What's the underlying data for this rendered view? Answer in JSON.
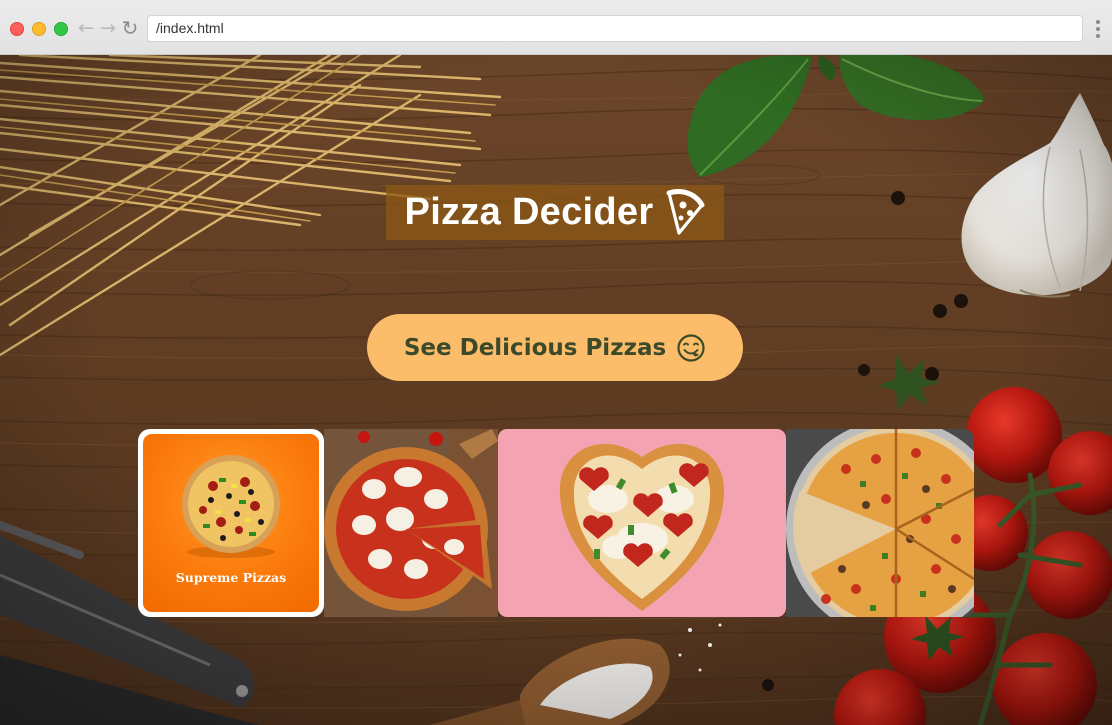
{
  "browser": {
    "url": "/index.html",
    "nav": {
      "back_icon": "arrow-left-icon",
      "forward_icon": "arrow-right-icon",
      "reload_icon": "reload-icon"
    }
  },
  "hero": {
    "title": "Pizza Decider",
    "title_icon": "pizza-slice-icon",
    "cta_label": "See Delicious Pizzas",
    "cta_icon": "smiling-face-icon"
  },
  "gallery": {
    "cards": [
      {
        "id": "supreme",
        "label": "Supreme Pizzas"
      },
      {
        "id": "margherita",
        "label": ""
      },
      {
        "id": "heart",
        "label": ""
      },
      {
        "id": "veggie",
        "label": ""
      }
    ]
  },
  "colors": {
    "title_bg": "#8c5816",
    "cta_bg": "#fbbd6a",
    "cta_text": "#3d4a2a",
    "supreme_orange": "#fb7a0c",
    "heart_bg": "#f4a3b3"
  }
}
